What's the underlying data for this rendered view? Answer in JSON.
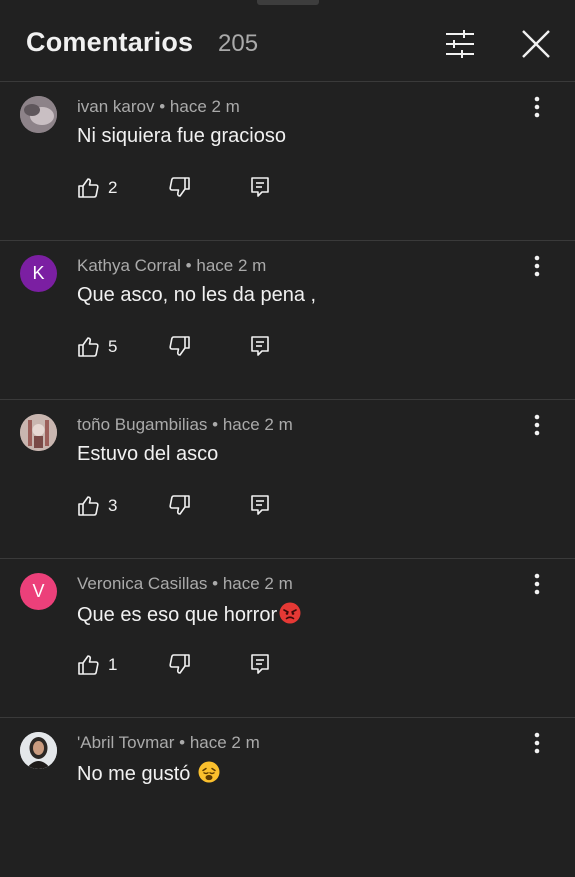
{
  "header": {
    "title": "Comentarios",
    "count": "205"
  },
  "comments": [
    {
      "author": "ivan karov",
      "time": "hace 2 m",
      "text": "Ni siquiera fue gracioso",
      "likes": "2",
      "avatar": "photo",
      "avatar_color": "#9a8f96"
    },
    {
      "author": "Kathya Corral",
      "time": "hace 2 m",
      "text": "Que asco,  no les da pena ,",
      "likes": "5",
      "avatar": "K",
      "avatar_color": "#7b1fa2"
    },
    {
      "author": "toño Bugambilias",
      "time": "hace 2 m",
      "text": "Estuvo del asco",
      "likes": "3",
      "avatar": "photo",
      "avatar_color": "#b9a7a2"
    },
    {
      "author": "Veronica Casillas",
      "time": "hace 2 m",
      "text": "Que es eso que horror",
      "emoji": "angry-face-emoji",
      "likes": "1",
      "avatar": "V",
      "avatar_color": "#ec407a"
    },
    {
      "author": "'Abril Tovmar",
      "time": "hace 2 m",
      "text": "No me gustó",
      "emoji": "weary-face-emoji",
      "likes": "",
      "avatar": "photo",
      "avatar_color": "#d9dde2"
    }
  ],
  "colors": {
    "background": "#212121",
    "divider": "#3a3a3a",
    "primary_text": "#f1f1f1",
    "secondary_text": "#aaaaaa"
  },
  "icons": [
    "filter-icon",
    "close-icon",
    "more-vert-icon",
    "thumb-up-icon",
    "thumb-down-icon",
    "reply-icon"
  ]
}
